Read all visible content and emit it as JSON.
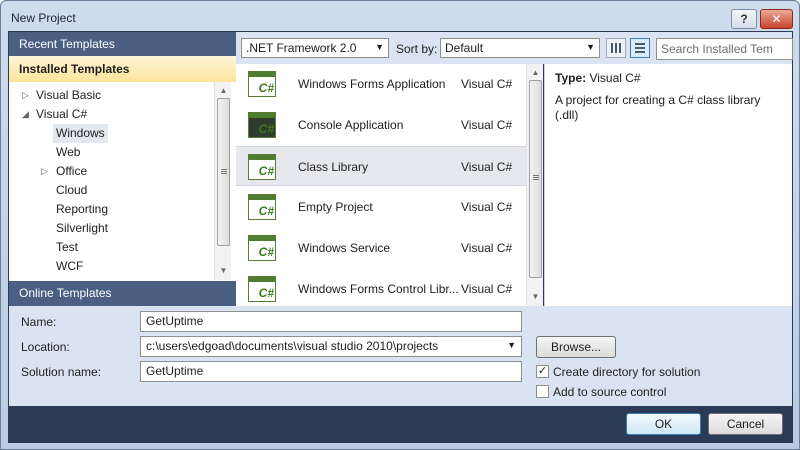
{
  "window": {
    "title": "New Project",
    "help_label": "?",
    "close_label": "✕"
  },
  "left_panel": {
    "recent_label": "Recent Templates",
    "installed_label": "Installed Templates",
    "online_label": "Online Templates",
    "tree": [
      {
        "label": "Visual Basic",
        "arrow": "▷",
        "level": 0
      },
      {
        "label": "Visual C#",
        "arrow": "◢",
        "level": 0
      },
      {
        "label": "Windows",
        "level": 1,
        "selected": true
      },
      {
        "label": "Web",
        "level": 1
      },
      {
        "label": "Office",
        "arrow": "▷",
        "level": 1
      },
      {
        "label": "Cloud",
        "level": 1
      },
      {
        "label": "Reporting",
        "level": 1
      },
      {
        "label": "Silverlight",
        "level": 1
      },
      {
        "label": "Test",
        "level": 1
      },
      {
        "label": "WCF",
        "level": 1
      }
    ]
  },
  "toolbar": {
    "framework": ".NET Framework 2.0",
    "sort_label": "Sort by:",
    "sort_value": "Default",
    "search_placeholder": "Search Installed Tem"
  },
  "templates": [
    {
      "name": "Windows Forms Application",
      "lang": "Visual C#",
      "icon": "windows-forms-icon"
    },
    {
      "name": "Console Application",
      "lang": "Visual C#",
      "icon": "console-icon"
    },
    {
      "name": "Class Library",
      "lang": "Visual C#",
      "icon": "class-library-icon",
      "selected": true
    },
    {
      "name": "Empty Project",
      "lang": "Visual C#",
      "icon": "empty-project-icon"
    },
    {
      "name": "Windows Service",
      "lang": "Visual C#",
      "icon": "windows-service-icon"
    },
    {
      "name": "Windows Forms Control Libr...",
      "lang": "Visual C#",
      "icon": "control-library-icon"
    }
  ],
  "info": {
    "type_label": "Type:",
    "type_value": "Visual C#",
    "description": "A project for creating a C# class library (.dll)"
  },
  "form": {
    "name_label": "Name:",
    "name_value": "GetUptime",
    "location_label": "Location:",
    "location_value": "c:\\users\\edgoad\\documents\\visual studio 2010\\projects",
    "solution_label": "Solution name:",
    "solution_value": "GetUptime",
    "browse_label": "Browse...",
    "create_dir_label": "Create directory for solution",
    "create_dir_checked": true,
    "source_control_label": "Add to source control",
    "source_control_checked": false
  },
  "buttons": {
    "ok": "OK",
    "cancel": "Cancel"
  }
}
